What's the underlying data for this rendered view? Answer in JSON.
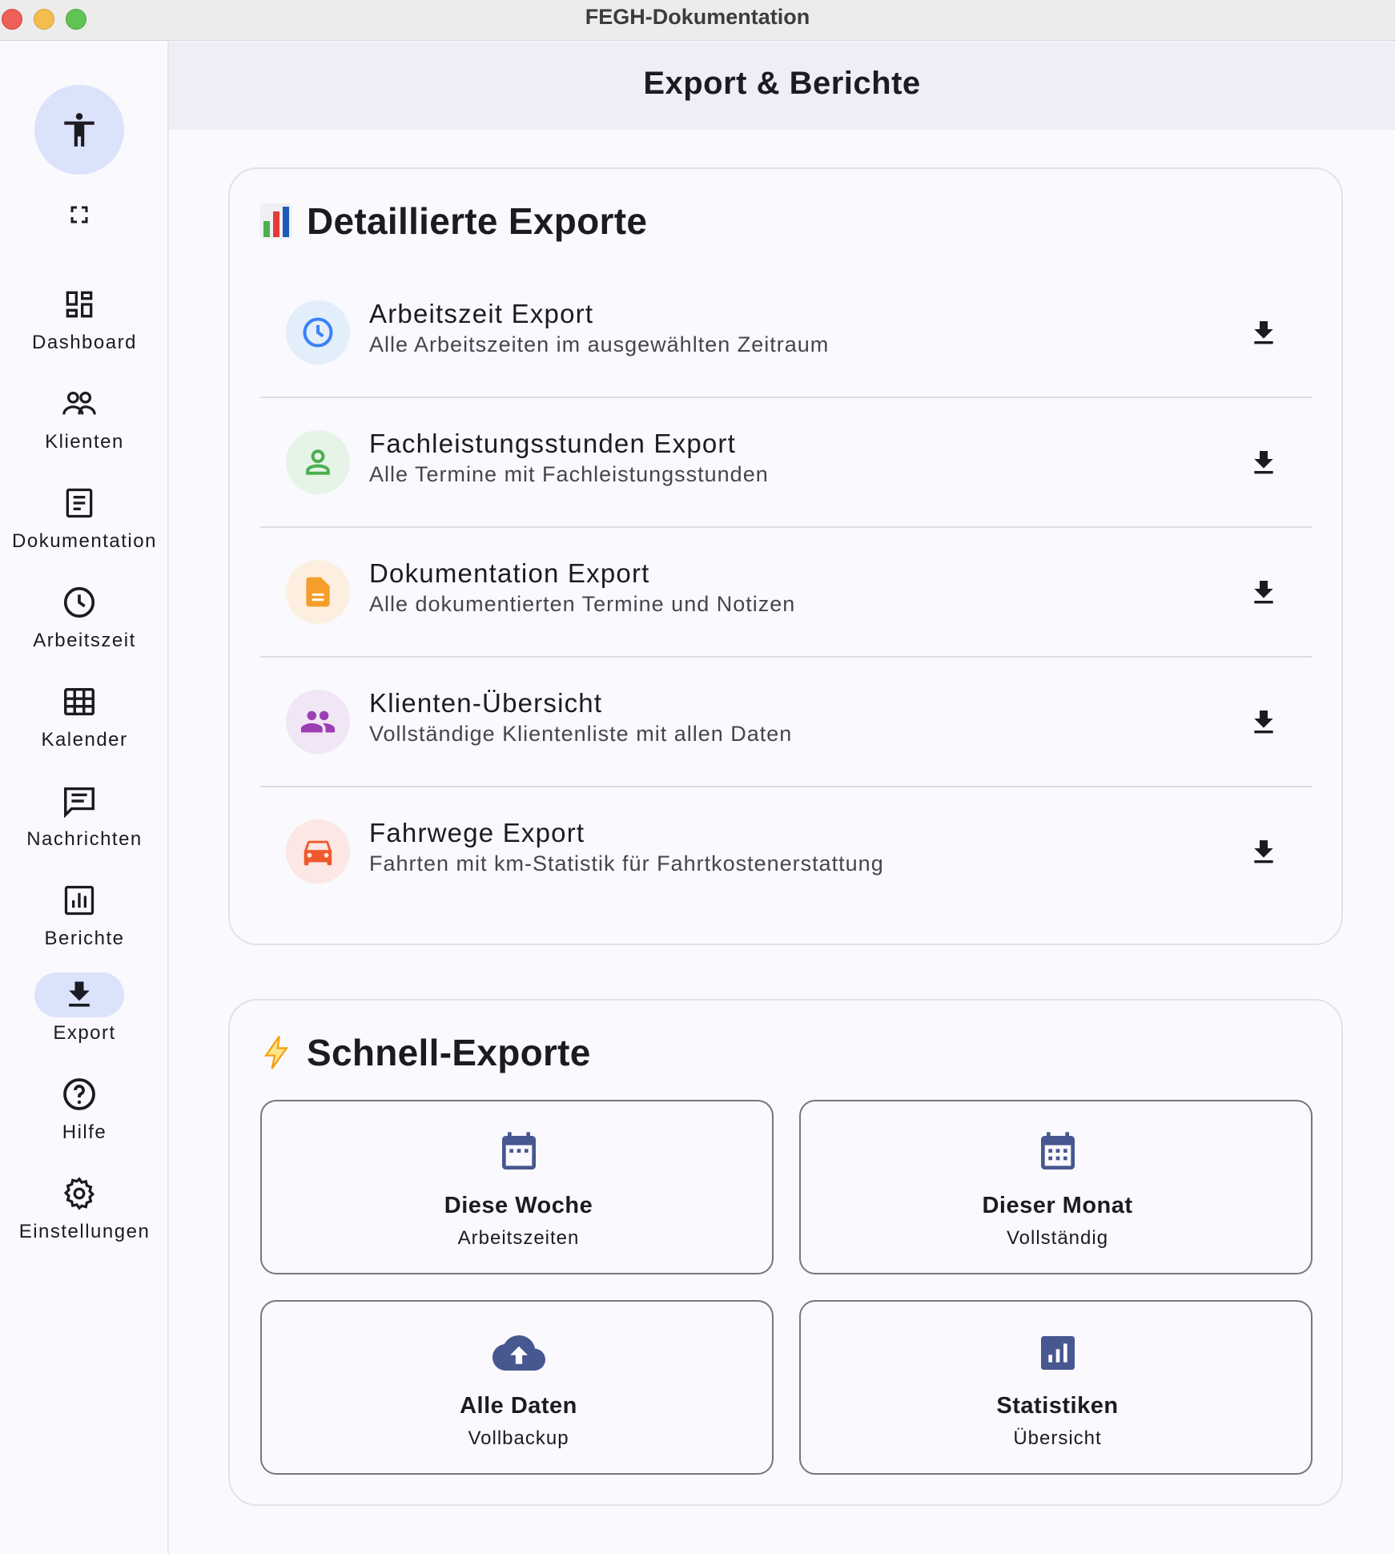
{
  "window": {
    "title": "FEGH-Dokumentation"
  },
  "header": {
    "title": "Export & Berichte"
  },
  "sidebar": {
    "accessibility_icon": "accessibility-icon",
    "fullscreen_icon": "fullscreen-icon",
    "items": [
      {
        "label": "Dashboard",
        "icon": "dashboard-icon",
        "active": false
      },
      {
        "label": "Klienten",
        "icon": "people-icon",
        "active": false
      },
      {
        "label": "Dokumentation",
        "icon": "document-icon",
        "active": false
      },
      {
        "label": "Arbeitszeit",
        "icon": "clock-icon",
        "active": false
      },
      {
        "label": "Kalender",
        "icon": "calendar-grid-icon",
        "active": false
      },
      {
        "label": "Nachrichten",
        "icon": "message-icon",
        "active": false
      },
      {
        "label": "Berichte",
        "icon": "report-icon",
        "active": false
      },
      {
        "label": "Export",
        "icon": "download-icon",
        "active": true
      },
      {
        "label": "Hilfe",
        "icon": "help-icon",
        "active": false
      },
      {
        "label": "Einstellungen",
        "icon": "gear-icon",
        "active": false
      }
    ]
  },
  "detailed": {
    "title": "Detaillierte Exporte",
    "icon": "bar-chart-emoji-icon",
    "items": [
      {
        "title": "Arbeitszeit Export",
        "subtitle": "Alle Arbeitszeiten im ausgewählten Zeitraum",
        "icon": "clock-icon",
        "color": "#3b82f6",
        "bg": "#e3eefb"
      },
      {
        "title": "Fachleistungsstunden Export",
        "subtitle": "Alle Termine mit Fachleistungsstunden",
        "icon": "person-icon",
        "color": "#4caf50",
        "bg": "#e6f3e7"
      },
      {
        "title": "Dokumentation Export",
        "subtitle": "Alle dokumentierten Termine und Notizen",
        "icon": "document-icon",
        "color": "#f59e2b",
        "bg": "#fcefe0"
      },
      {
        "title": "Klienten-Übersicht",
        "subtitle": "Vollständige Klientenliste mit allen Daten",
        "icon": "people-icon",
        "color": "#9c3fb5",
        "bg": "#f1e6f5"
      },
      {
        "title": "Fahrwege Export",
        "subtitle": "Fahrten mit km-Statistik für Fahrtkostenerstattung",
        "icon": "car-icon",
        "color": "#f0592d",
        "bg": "#fbe7e3"
      }
    ]
  },
  "quick": {
    "title": "Schnell-Exporte",
    "icon": "lightning-icon",
    "items": [
      {
        "title": "Diese Woche",
        "subtitle": "Arbeitszeiten",
        "icon": "calendar-week-icon"
      },
      {
        "title": "Dieser Monat",
        "subtitle": "Vollständig",
        "icon": "calendar-month-icon"
      },
      {
        "title": "Alle Daten",
        "subtitle": "Vollbackup",
        "icon": "cloud-upload-icon"
      },
      {
        "title": "Statistiken",
        "subtitle": "Übersicht",
        "icon": "statistics-icon"
      }
    ]
  },
  "colors": {
    "accent_icon": "#47578f",
    "active_bg": "#dbe3fa"
  }
}
